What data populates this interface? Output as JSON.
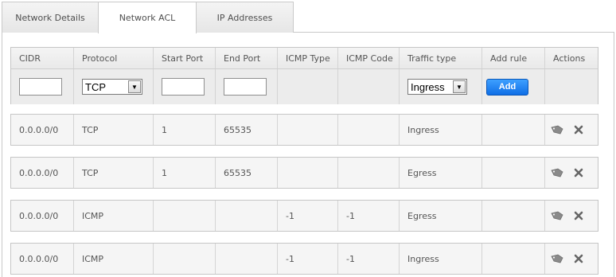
{
  "tabs": [
    {
      "label": "Network Details"
    },
    {
      "label": "Network ACL"
    },
    {
      "label": "IP Addresses"
    }
  ],
  "columns": [
    "CIDR",
    "Protocol",
    "Start Port",
    "End Port",
    "ICMP Type",
    "ICMP Code",
    "Traffic type",
    "Add rule",
    "Actions"
  ],
  "form": {
    "cidr_value": "",
    "protocol_selected": "TCP",
    "start_port_value": "",
    "end_port_value": "",
    "traffic_selected": "Ingress",
    "add_label": "Add"
  },
  "rules": [
    {
      "cidr": "0.0.0.0/0",
      "protocol": "TCP",
      "start_port": "1",
      "end_port": "65535",
      "icmp_type": "",
      "icmp_code": "",
      "traffic": "Ingress"
    },
    {
      "cidr": "0.0.0.0/0",
      "protocol": "TCP",
      "start_port": "1",
      "end_port": "65535",
      "icmp_type": "",
      "icmp_code": "",
      "traffic": "Egress"
    },
    {
      "cidr": "0.0.0.0/0",
      "protocol": "ICMP",
      "start_port": "",
      "end_port": "",
      "icmp_type": "-1",
      "icmp_code": "-1",
      "traffic": "Egress"
    },
    {
      "cidr": "0.0.0.0/0",
      "protocol": "ICMP",
      "start_port": "",
      "end_port": "",
      "icmp_type": "-1",
      "icmp_code": "-1",
      "traffic": "Ingress"
    }
  ],
  "icons": {
    "tag": "tag-icon",
    "remove": "close-icon",
    "dropdown": "chevron-down-icon"
  }
}
